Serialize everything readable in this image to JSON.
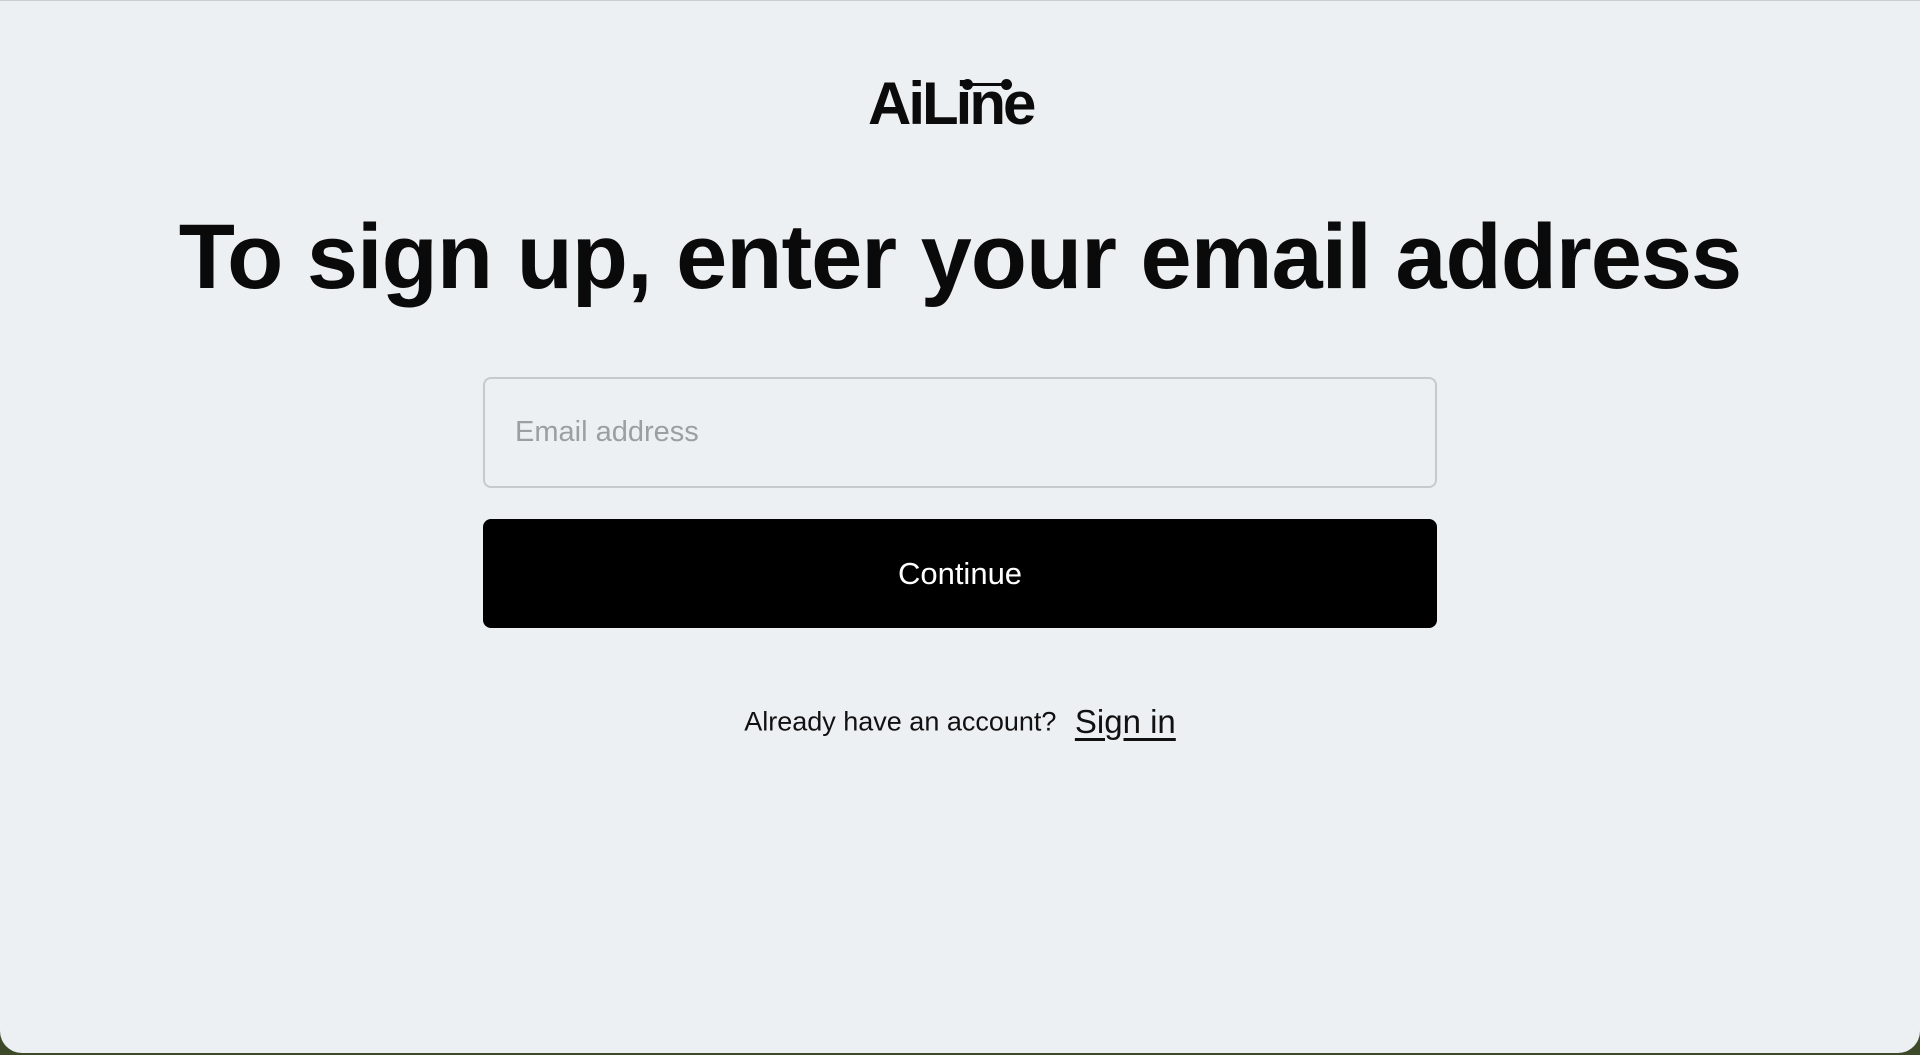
{
  "brand": {
    "logo_text": "AiLine"
  },
  "signup": {
    "heading": "To sign up, enter your email address",
    "email_placeholder": "Email address",
    "email_value": "",
    "continue_label": "Continue"
  },
  "footer": {
    "prompt": "Already have an account?",
    "signin_label": "Sign in"
  }
}
